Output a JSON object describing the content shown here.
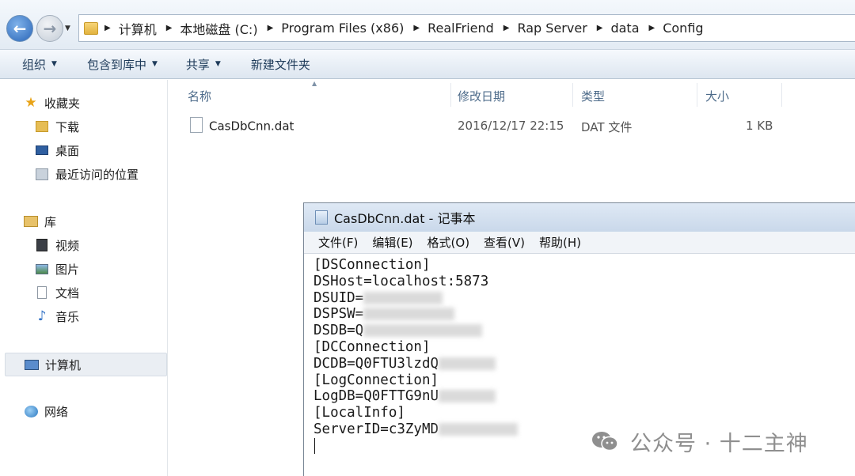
{
  "breadcrumb": [
    "计算机",
    "本地磁盘 (C:)",
    "Program Files (x86)",
    "RealFriend",
    "Rap Server",
    "data",
    "Config"
  ],
  "toolbar": {
    "organize": "组织",
    "include_in_library": "包含到库中",
    "share": "共享",
    "new_folder": "新建文件夹"
  },
  "sidebar": {
    "favorites": "收藏夹",
    "downloads": "下载",
    "desktop": "桌面",
    "recent_places": "最近访问的位置",
    "libraries": "库",
    "videos": "视频",
    "pictures": "图片",
    "documents": "文档",
    "music": "音乐",
    "computer": "计算机",
    "network": "网络"
  },
  "columns": {
    "name": "名称",
    "modified": "修改日期",
    "type": "类型",
    "size": "大小"
  },
  "files": [
    {
      "name": "CasDbCnn.dat",
      "modified": "2016/12/17 22:15",
      "type": "DAT 文件",
      "size": "1 KB"
    }
  ],
  "notepad": {
    "title": "CasDbCnn.dat - 记事本",
    "menu": {
      "file": "文件(F)",
      "edit": "编辑(E)",
      "format": "格式(O)",
      "view": "查看(V)",
      "help": "帮助(H)"
    },
    "lines": [
      "[DSConnection]",
      "DSHost=localhost:5873",
      "DSUID=",
      "DSPSW=",
      "DSDB=Q",
      "[DCConnection]",
      "DCDB=Q0FTU3lzdQ",
      "[LogConnection]",
      "LogDB=Q0FTTG9nU",
      "[LocalInfo]",
      "ServerID=c3ZyMD"
    ]
  },
  "watermark": {
    "text": "公众号 · 十二主神"
  }
}
